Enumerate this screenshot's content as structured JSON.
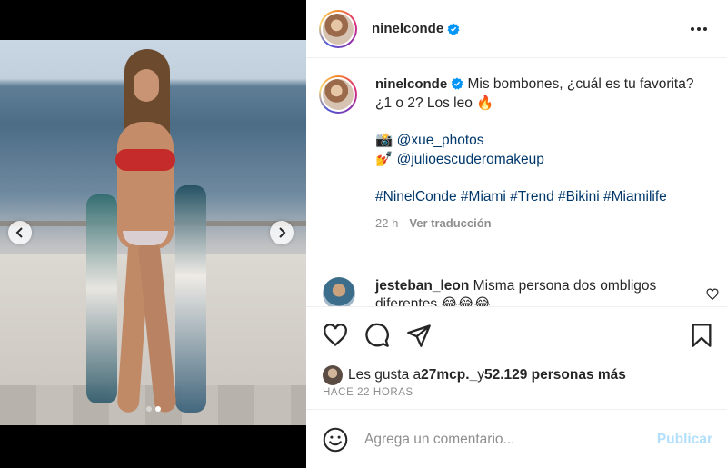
{
  "post": {
    "username": "ninelconde",
    "verified": true,
    "caption_line1": " Mis bombones, ¿cuál es tu favorita?",
    "caption_line2": "¿1 o 2? Los leo 🔥",
    "credit1_emoji": "📸",
    "credit1_tag": "@xue_photos",
    "credit2_emoji": "💅",
    "credit2_tag": "@julioescuderomakeup",
    "hashtags": "#NinelConde #Miami #Trend #Bikini #Miamilife",
    "age": "22 h",
    "translate_label": "Ver traducción"
  },
  "comment": {
    "username": "jesteban_leon",
    "text": " Misma persona dos ombligos diferentes 😂😂😂"
  },
  "likes": {
    "prefix": "Les gusta a ",
    "user": "27mcp._",
    "middle": " y ",
    "count": "52.129 personas más"
  },
  "timestamp": "HACE 22 HORAS",
  "add_comment": {
    "placeholder": "Agrega un comentario...",
    "publish_label": "Publicar"
  },
  "carousel": {
    "slides": 2,
    "active_index": 1
  },
  "colors": {
    "link": "#00376b",
    "verified": "#0095f6",
    "publish_disabled": "#b2dffc",
    "muted": "#8e8e8e"
  }
}
